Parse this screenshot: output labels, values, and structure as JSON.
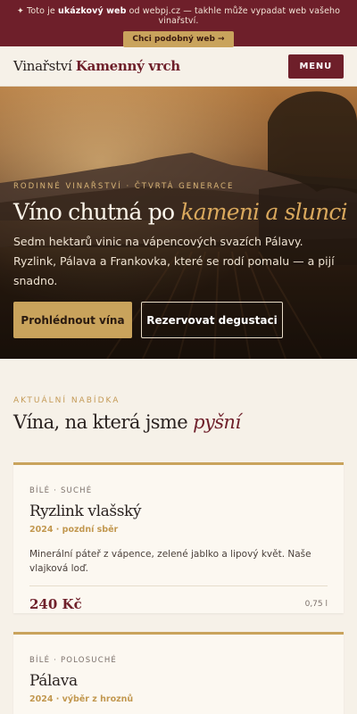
{
  "promo": {
    "prefix": "✦ Toto je ",
    "bold": "ukázkový web",
    "suffix": " od webpj.cz — takhle může vypadat web vašeho vinařství.",
    "button_label": "Chci podobný web →"
  },
  "header": {
    "brand_prefix": "Vinařství ",
    "brand_accent": "Kamenný vrch",
    "menu_label": "MENU"
  },
  "hero": {
    "eyebrow": "RODINNÉ VINAŘSTVÍ · ČTVRTÁ GENERACE",
    "title_plain": "Víno chutná po ",
    "title_accent": "kameni a slunci",
    "description": "Sedm hektarů vinic na vápencových svazích Pálavy. Ryzlink, Pálava a Frankovka, které se rodí pomalu — a pijí snadno.",
    "primary_button": "Prohlédnout vína",
    "secondary_button": "Rezervovat degustaci"
  },
  "offer": {
    "eyebrow": "AKTUÁLNÍ NABÍDKA",
    "title_plain": "Vína, na která jsme ",
    "title_accent": "pyšní"
  },
  "wines": [
    {
      "meta": "BÍLÉ · SUCHÉ",
      "name": "Ryzlink vlašský",
      "vintage": "2024 · pozdní sběr",
      "description": "Minerální páteř z vápence, zelené jablko a lipový květ. Naše vlajková loď.",
      "price": "240 Kč",
      "volume": "0,75 l"
    },
    {
      "meta": "BÍLÉ · POLOSUCHÉ",
      "name": "Pálava",
      "vintage": "2024 · výběr z hroznů"
    }
  ],
  "colors": {
    "burgundy": "#6e1f2a",
    "gold": "#c9a35c",
    "cream": "#f6f1e8"
  }
}
